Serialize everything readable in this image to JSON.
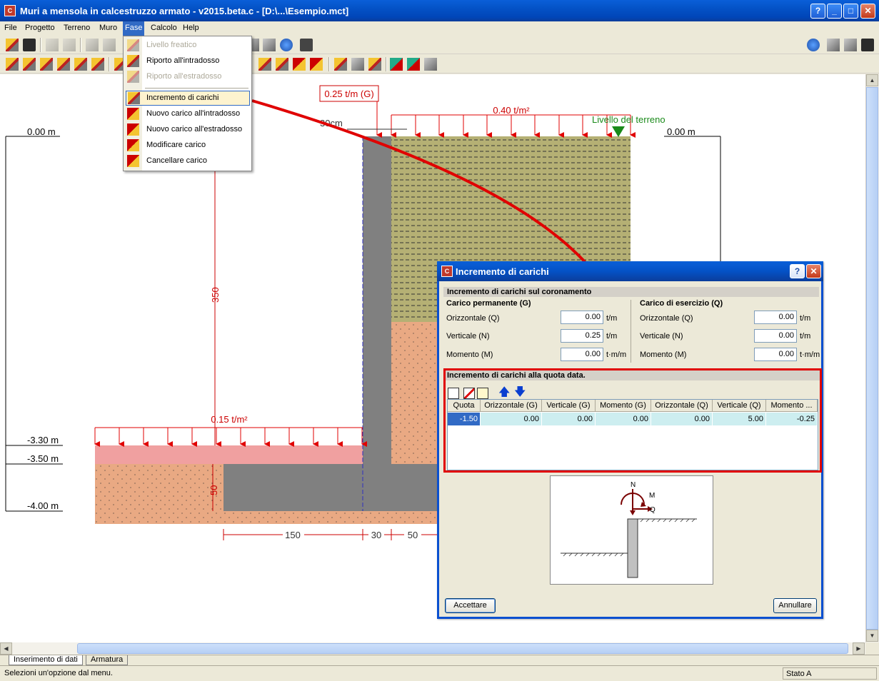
{
  "window": {
    "title": "Muri a mensola in calcestruzzo armato - v2015.beta.c - [D:\\...\\Esempio.mct]",
    "icon_text": "C",
    "help_btn": "?",
    "min_btn": "_",
    "max_btn": "□",
    "close_btn": "✕"
  },
  "menubar": {
    "file": "File",
    "progetto": "Progetto",
    "terreno": "Terreno",
    "muro": "Muro",
    "fase": "Fase",
    "calcolo": "Calcolo",
    "help": "Help"
  },
  "fase_menu": {
    "livello_freatico": "Livello freatico",
    "riporto_intradosso": "Riporto all'intradosso",
    "riporto_estradosso": "Riporto all'estradosso",
    "incremento_carichi": "Incremento di carichi",
    "nuovo_carico_intradosso": "Nuovo carico all'intradosso",
    "nuovo_carico_estradosso": "Nuovo carico all'estradosso",
    "modificare_carico": "Modificare carico",
    "cancellare_carico": "Cancellare carico"
  },
  "drawing": {
    "crown_load": "0.25 t/m (G)",
    "top_load": "0.40 t/m²",
    "heel_load": "0.15 t/m²",
    "width_30cm": "30cm",
    "terrain_level": "Livello del terreno",
    "level_0_left": "0.00 m",
    "level_0_right": "0.00 m",
    "level_330": "-3.30 m",
    "level_350": "-3.50 m",
    "level_400": "-4.00 m",
    "dim_height": "350",
    "dim_footing": "50",
    "dim_150": "150",
    "dim_30": "30",
    "dim_50": "50"
  },
  "dialog": {
    "title": "Incremento di carichi",
    "section_crown": "Incremento di carichi sul coronamento",
    "permanent_title": "Carico permanente (G)",
    "service_title": "Carico di esercizio (Q)",
    "perm": [
      {
        "label": "Orizzontale (Q)",
        "value": "0.00",
        "unit": "t/m"
      },
      {
        "label": "Verticale (N)",
        "value": "0.25",
        "unit": "t/m"
      },
      {
        "label": "Momento (M)",
        "value": "0.00",
        "unit": "t·m/m"
      }
    ],
    "serv": [
      {
        "label": "Orizzontale (Q)",
        "value": "0.00",
        "unit": "t/m"
      },
      {
        "label": "Verticale (N)",
        "value": "0.00",
        "unit": "t/m"
      },
      {
        "label": "Momento (M)",
        "value": "0.00",
        "unit": "t·m/m"
      }
    ],
    "section_level": "Incremento di carichi alla quota data.",
    "columns": [
      "Quota",
      "Orizzontale (G)",
      "Verticale (G)",
      "Momento (G)",
      "Orizzontale (Q)",
      "Verticale (Q)",
      "Momento ..."
    ],
    "row": [
      "-1.50",
      "0.00",
      "0.00",
      "0.00",
      "0.00",
      "5.00",
      "-0.25"
    ],
    "preview": {
      "n": "N",
      "m": "M",
      "q": "Q"
    },
    "accept": "Accettare",
    "cancel": "Annullare"
  },
  "tabs": {
    "input": "Inserimento di dati",
    "reinforcement": "Armatura"
  },
  "status": {
    "message": "Selezioni un'opzione dal menu.",
    "state": "Stato A"
  },
  "colors": {
    "arrow_red": "#e00000",
    "concrete": "#808080",
    "fill_soil": "#b5b074",
    "natural_soil": "#e9a983",
    "pink_layer": "#f0a0a0",
    "terrain_green": "#1a8a1a",
    "dimension_red": "#cc0000"
  }
}
